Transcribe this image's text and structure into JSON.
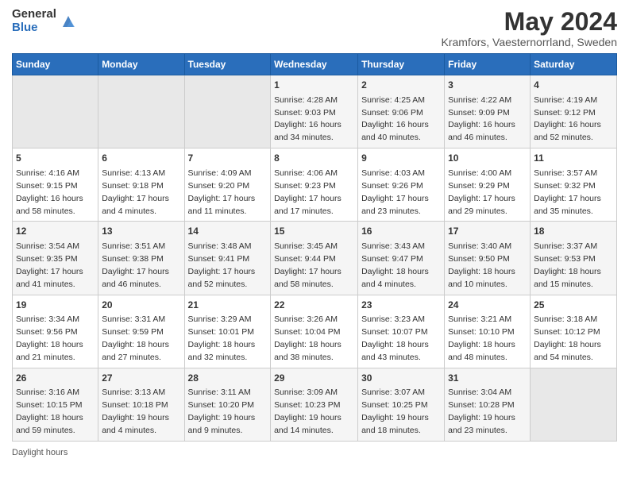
{
  "header": {
    "logo_general": "General",
    "logo_blue": "Blue",
    "title": "May 2024",
    "subtitle": "Kramfors, Vaesternorrland, Sweden"
  },
  "days_of_week": [
    "Sunday",
    "Monday",
    "Tuesday",
    "Wednesday",
    "Thursday",
    "Friday",
    "Saturday"
  ],
  "footer": {
    "daylight_hours": "Daylight hours"
  },
  "weeks": [
    {
      "days": [
        {
          "num": "",
          "sunrise": "",
          "sunset": "",
          "daylight": ""
        },
        {
          "num": "",
          "sunrise": "",
          "sunset": "",
          "daylight": ""
        },
        {
          "num": "",
          "sunrise": "",
          "sunset": "",
          "daylight": ""
        },
        {
          "num": "1",
          "sunrise": "Sunrise: 4:28 AM",
          "sunset": "Sunset: 9:03 PM",
          "daylight": "Daylight: 16 hours and 34 minutes."
        },
        {
          "num": "2",
          "sunrise": "Sunrise: 4:25 AM",
          "sunset": "Sunset: 9:06 PM",
          "daylight": "Daylight: 16 hours and 40 minutes."
        },
        {
          "num": "3",
          "sunrise": "Sunrise: 4:22 AM",
          "sunset": "Sunset: 9:09 PM",
          "daylight": "Daylight: 16 hours and 46 minutes."
        },
        {
          "num": "4",
          "sunrise": "Sunrise: 4:19 AM",
          "sunset": "Sunset: 9:12 PM",
          "daylight": "Daylight: 16 hours and 52 minutes."
        }
      ]
    },
    {
      "days": [
        {
          "num": "5",
          "sunrise": "Sunrise: 4:16 AM",
          "sunset": "Sunset: 9:15 PM",
          "daylight": "Daylight: 16 hours and 58 minutes."
        },
        {
          "num": "6",
          "sunrise": "Sunrise: 4:13 AM",
          "sunset": "Sunset: 9:18 PM",
          "daylight": "Daylight: 17 hours and 4 minutes."
        },
        {
          "num": "7",
          "sunrise": "Sunrise: 4:09 AM",
          "sunset": "Sunset: 9:20 PM",
          "daylight": "Daylight: 17 hours and 11 minutes."
        },
        {
          "num": "8",
          "sunrise": "Sunrise: 4:06 AM",
          "sunset": "Sunset: 9:23 PM",
          "daylight": "Daylight: 17 hours and 17 minutes."
        },
        {
          "num": "9",
          "sunrise": "Sunrise: 4:03 AM",
          "sunset": "Sunset: 9:26 PM",
          "daylight": "Daylight: 17 hours and 23 minutes."
        },
        {
          "num": "10",
          "sunrise": "Sunrise: 4:00 AM",
          "sunset": "Sunset: 9:29 PM",
          "daylight": "Daylight: 17 hours and 29 minutes."
        },
        {
          "num": "11",
          "sunrise": "Sunrise: 3:57 AM",
          "sunset": "Sunset: 9:32 PM",
          "daylight": "Daylight: 17 hours and 35 minutes."
        }
      ]
    },
    {
      "days": [
        {
          "num": "12",
          "sunrise": "Sunrise: 3:54 AM",
          "sunset": "Sunset: 9:35 PM",
          "daylight": "Daylight: 17 hours and 41 minutes."
        },
        {
          "num": "13",
          "sunrise": "Sunrise: 3:51 AM",
          "sunset": "Sunset: 9:38 PM",
          "daylight": "Daylight: 17 hours and 46 minutes."
        },
        {
          "num": "14",
          "sunrise": "Sunrise: 3:48 AM",
          "sunset": "Sunset: 9:41 PM",
          "daylight": "Daylight: 17 hours and 52 minutes."
        },
        {
          "num": "15",
          "sunrise": "Sunrise: 3:45 AM",
          "sunset": "Sunset: 9:44 PM",
          "daylight": "Daylight: 17 hours and 58 minutes."
        },
        {
          "num": "16",
          "sunrise": "Sunrise: 3:43 AM",
          "sunset": "Sunset: 9:47 PM",
          "daylight": "Daylight: 18 hours and 4 minutes."
        },
        {
          "num": "17",
          "sunrise": "Sunrise: 3:40 AM",
          "sunset": "Sunset: 9:50 PM",
          "daylight": "Daylight: 18 hours and 10 minutes."
        },
        {
          "num": "18",
          "sunrise": "Sunrise: 3:37 AM",
          "sunset": "Sunset: 9:53 PM",
          "daylight": "Daylight: 18 hours and 15 minutes."
        }
      ]
    },
    {
      "days": [
        {
          "num": "19",
          "sunrise": "Sunrise: 3:34 AM",
          "sunset": "Sunset: 9:56 PM",
          "daylight": "Daylight: 18 hours and 21 minutes."
        },
        {
          "num": "20",
          "sunrise": "Sunrise: 3:31 AM",
          "sunset": "Sunset: 9:59 PM",
          "daylight": "Daylight: 18 hours and 27 minutes."
        },
        {
          "num": "21",
          "sunrise": "Sunrise: 3:29 AM",
          "sunset": "Sunset: 10:01 PM",
          "daylight": "Daylight: 18 hours and 32 minutes."
        },
        {
          "num": "22",
          "sunrise": "Sunrise: 3:26 AM",
          "sunset": "Sunset: 10:04 PM",
          "daylight": "Daylight: 18 hours and 38 minutes."
        },
        {
          "num": "23",
          "sunrise": "Sunrise: 3:23 AM",
          "sunset": "Sunset: 10:07 PM",
          "daylight": "Daylight: 18 hours and 43 minutes."
        },
        {
          "num": "24",
          "sunrise": "Sunrise: 3:21 AM",
          "sunset": "Sunset: 10:10 PM",
          "daylight": "Daylight: 18 hours and 48 minutes."
        },
        {
          "num": "25",
          "sunrise": "Sunrise: 3:18 AM",
          "sunset": "Sunset: 10:12 PM",
          "daylight": "Daylight: 18 hours and 54 minutes."
        }
      ]
    },
    {
      "days": [
        {
          "num": "26",
          "sunrise": "Sunrise: 3:16 AM",
          "sunset": "Sunset: 10:15 PM",
          "daylight": "Daylight: 18 hours and 59 minutes."
        },
        {
          "num": "27",
          "sunrise": "Sunrise: 3:13 AM",
          "sunset": "Sunset: 10:18 PM",
          "daylight": "Daylight: 19 hours and 4 minutes."
        },
        {
          "num": "28",
          "sunrise": "Sunrise: 3:11 AM",
          "sunset": "Sunset: 10:20 PM",
          "daylight": "Daylight: 19 hours and 9 minutes."
        },
        {
          "num": "29",
          "sunrise": "Sunrise: 3:09 AM",
          "sunset": "Sunset: 10:23 PM",
          "daylight": "Daylight: 19 hours and 14 minutes."
        },
        {
          "num": "30",
          "sunrise": "Sunrise: 3:07 AM",
          "sunset": "Sunset: 10:25 PM",
          "daylight": "Daylight: 19 hours and 18 minutes."
        },
        {
          "num": "31",
          "sunrise": "Sunrise: 3:04 AM",
          "sunset": "Sunset: 10:28 PM",
          "daylight": "Daylight: 19 hours and 23 minutes."
        },
        {
          "num": "",
          "sunrise": "",
          "sunset": "",
          "daylight": ""
        }
      ]
    }
  ]
}
